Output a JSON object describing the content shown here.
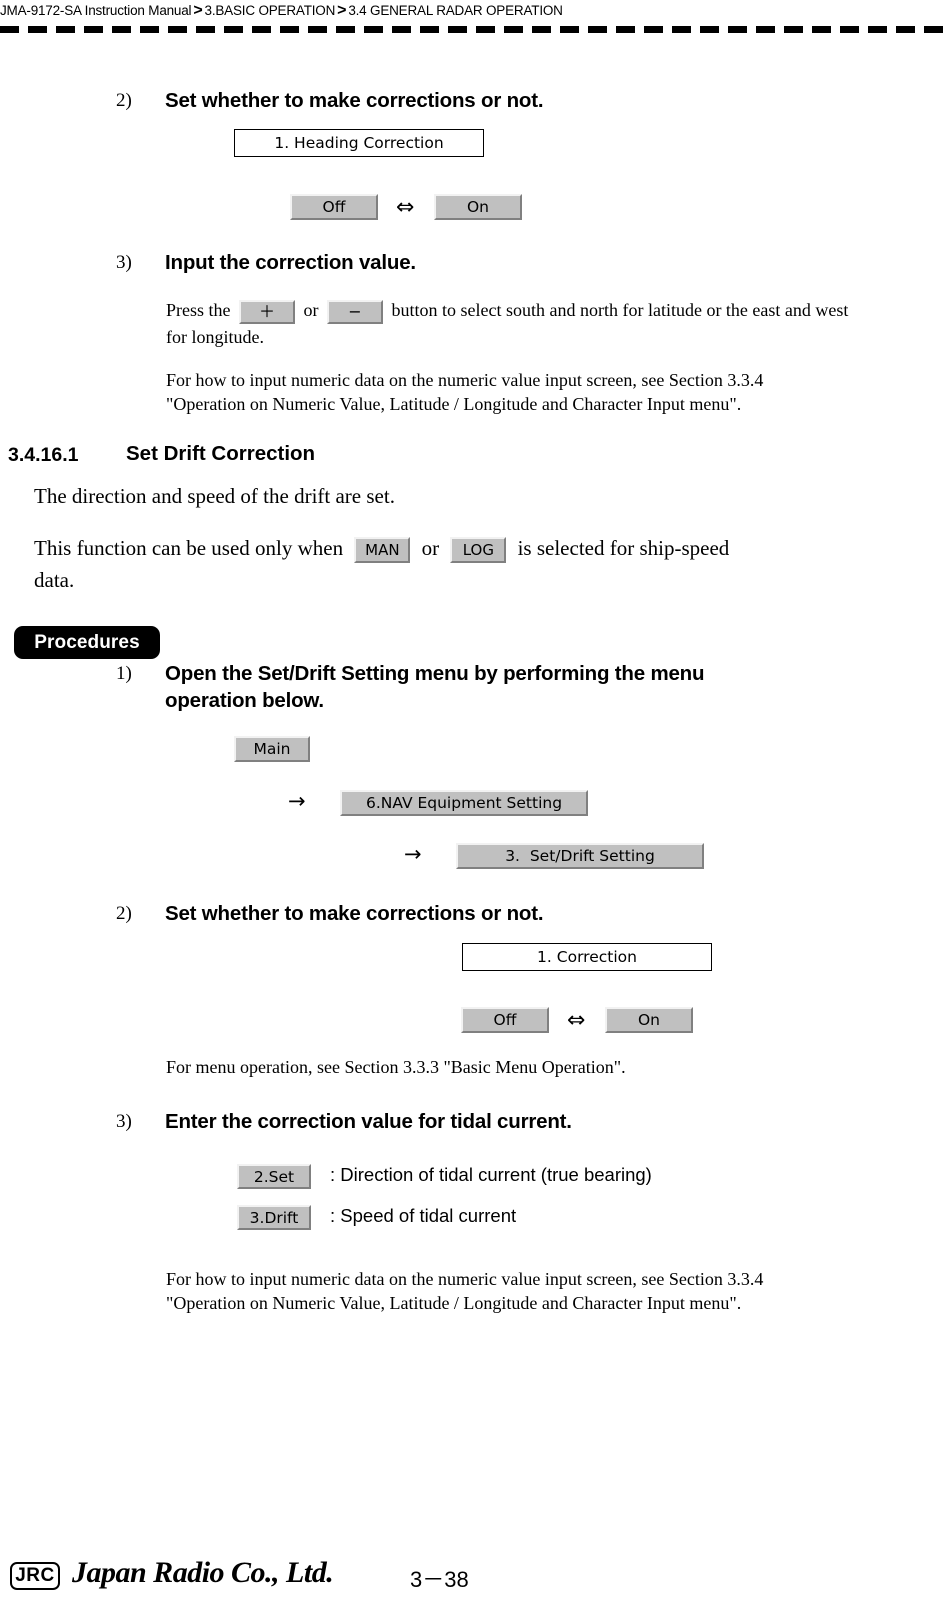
{
  "header": {
    "manual": "JMA-9172-SA Instruction Manual",
    "sep": ">",
    "chapter": "3.BASIC OPERATION",
    "section": "3.4  GENERAL RADAR OPERATION"
  },
  "top_section": {
    "step2": {
      "number": "2)",
      "title": "Set whether to make corrections or not.",
      "menu_box": "1. Heading Correction",
      "toggle": {
        "off_label": "Off",
        "arrow": "⇔",
        "on_label": "On"
      }
    },
    "step3": {
      "number": "3)",
      "title": "Input the correction value.",
      "press_prefix": "Press the",
      "plus_label": "＋",
      "or_label": "or",
      "minus_label": "−",
      "press_suffix": "button to select south and north for latitude or the east and west",
      "press_line2": "for longitude.",
      "reference_line1": "For how to input numeric data on the numeric value input screen, see Section 3.3.4",
      "reference_line2": "\"Operation on Numeric Value, Latitude / Longitude and Character Input menu\"."
    }
  },
  "section_heading": {
    "number": "3.4.16.1",
    "title": "Set Drift Correction"
  },
  "intro": {
    "line1": "The direction and speed of the drift are set.",
    "line2_prefix": "This function can be used only when",
    "man_label": "MAN",
    "or_label": "or",
    "log_label": "LOG",
    "line2_suffix": "is selected for ship-speed",
    "line3": "data."
  },
  "procedures": {
    "tag_label": "Procedures",
    "step1": {
      "number": "1)",
      "title_line1": "Open the Set/Drift Setting menu by performing the menu",
      "title_line2": "operation below.",
      "menu_path": [
        {
          "label": "Main",
          "arrow": ""
        },
        {
          "label": "6.NAV Equipment Setting",
          "arrow": "→"
        },
        {
          "label": "3.  Set/Drift Setting",
          "arrow": "→"
        }
      ]
    },
    "step2": {
      "number": "2)",
      "title": "Set whether to make corrections or not.",
      "menu_box": "1. Correction",
      "toggle": {
        "off_label": "Off",
        "arrow": "⇔",
        "on_label": "On"
      },
      "reference": "For menu operation, see Section 3.3.3 \"Basic Menu Operation\"."
    },
    "step3": {
      "number": "3)",
      "title": "Enter the correction value for tidal current.",
      "rows": [
        {
          "button": "2.Set",
          "description": ": Direction of tidal current (true bearing)"
        },
        {
          "button": "3.Drift",
          "description": ": Speed of tidal current"
        }
      ],
      "reference_line1": "For how to input numeric data on the numeric value input screen, see Section 3.3.4",
      "reference_line2": "\"Operation on Numeric Value, Latitude / Longitude and Character Input menu\"."
    }
  },
  "footer": {
    "logo_mark": "JRC",
    "company": "Japan Radio Co., Ltd.",
    "page": "3－38"
  }
}
